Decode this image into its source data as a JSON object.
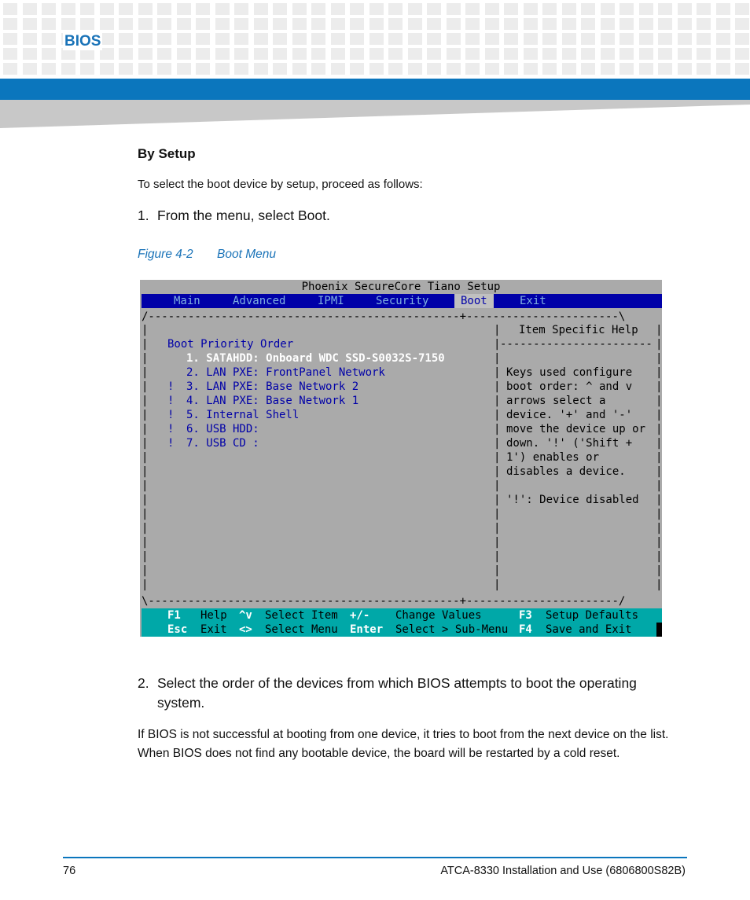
{
  "header": {
    "section": "BIOS"
  },
  "content": {
    "heading": "By Setup",
    "intro": "To select the boot device by setup, proceed as follows:",
    "step1": {
      "num": "1.",
      "text": "From the menu, select Boot."
    },
    "figure": {
      "label": "Figure 4-2",
      "title": "Boot Menu"
    },
    "step2": {
      "num": "2.",
      "text": "Select the order of the devices from which BIOS attempts to boot the operating system."
    },
    "note": "If BIOS is not successful at booting from one device, it tries to boot from the next device on the list. When BIOS does not find any bootable device, the board will be restarted by a cold reset."
  },
  "bios": {
    "title": "Phoenix SecureCore Tiano Setup",
    "menu": [
      "Main",
      "Advanced",
      "IPMI",
      "Security",
      "Boot",
      "Exit"
    ],
    "active_menu": "Boot",
    "border_top": "/-----------------------------------------------+-----------------------\\",
    "border_bottom": "\\-----------------------------------------------+-----------------------/",
    "boot_header": "Boot Priority Order",
    "boot_items": [
      {
        "mark": "",
        "text": "1. SATAHDD: Onboard WDC SSD-S0032S-7150",
        "selected": true
      },
      {
        "mark": "",
        "text": "2. LAN PXE: FrontPanel Network",
        "selected": false
      },
      {
        "mark": "!",
        "text": "3. LAN PXE: Base Network 2",
        "selected": false
      },
      {
        "mark": "!",
        "text": "4. LAN PXE: Base Network 1",
        "selected": false
      },
      {
        "mark": "!",
        "text": "5. Internal Shell",
        "selected": false
      },
      {
        "mark": "!",
        "text": "6. USB HDD:",
        "selected": false
      },
      {
        "mark": "!",
        "text": "7. USB CD :",
        "selected": false
      }
    ],
    "help_title": "Item Specific Help",
    "help_rule": "-----------------------",
    "help_lines": [
      "Keys used configure",
      "boot order: ^ and v",
      "arrows select a",
      "device. '+' and '-'",
      "move the device up or",
      "down. '!' ('Shift +",
      "1') enables or",
      "disables a device.",
      "",
      "'!': Device disabled"
    ],
    "footer": {
      "row1": [
        {
          "key": "F1",
          "desc": "Help"
        },
        {
          "key": "^v",
          "desc": "Select Item"
        },
        {
          "key": "+/-",
          "desc": "Change Values"
        },
        {
          "key": "F3",
          "desc": "Setup Defaults"
        }
      ],
      "row2": [
        {
          "key": "Esc",
          "desc": "Exit"
        },
        {
          "key": "<>",
          "desc": "Select Menu"
        },
        {
          "key": "Enter",
          "desc": "Select > Sub-Menu"
        },
        {
          "key": "F4",
          "desc": "Save and Exit"
        }
      ]
    }
  },
  "footer": {
    "page": "76",
    "doc": "ATCA-8330 Installation and Use (6806800S82B)"
  },
  "colors": {
    "brand_blue": "#0b76bd",
    "bios_gray": "#aaaaaa",
    "bios_blue": "#0000a8",
    "bios_cyan": "#00a8a8"
  }
}
